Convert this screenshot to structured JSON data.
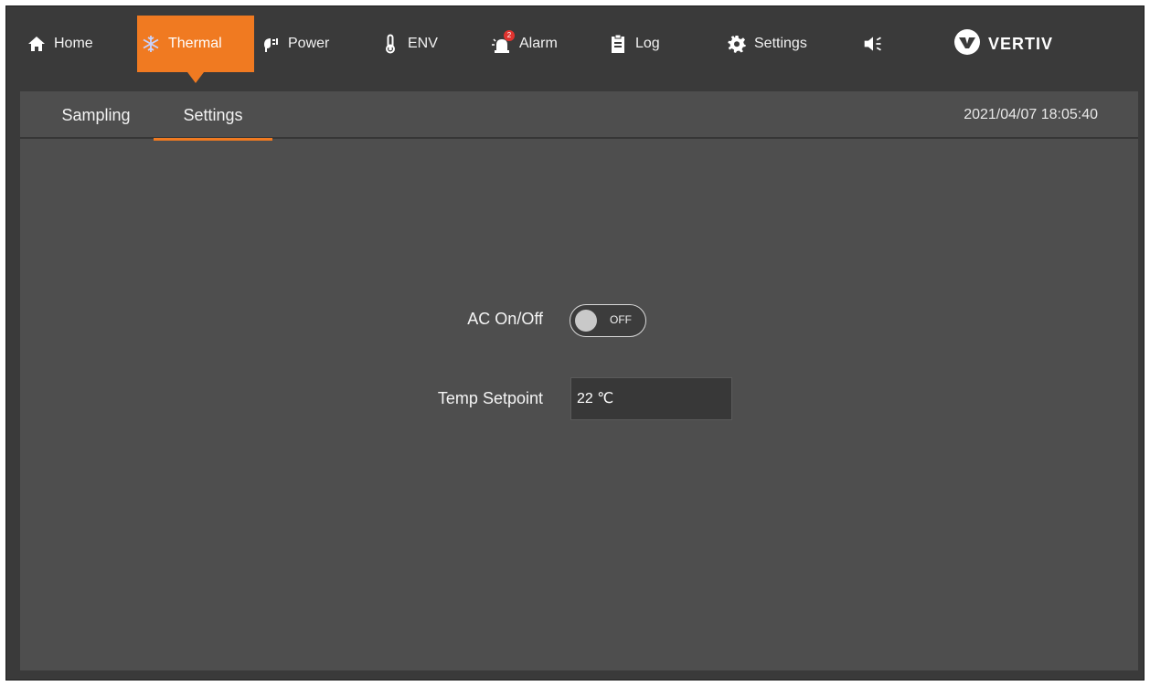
{
  "nav": {
    "items": [
      {
        "id": "home",
        "label": "Home",
        "icon": "home-icon"
      },
      {
        "id": "thermal",
        "label": "Thermal",
        "icon": "snowflake-icon",
        "active": true
      },
      {
        "id": "power",
        "label": "Power",
        "icon": "plug-icon"
      },
      {
        "id": "env",
        "label": "ENV",
        "icon": "thermometer-icon"
      },
      {
        "id": "alarm",
        "label": "Alarm",
        "icon": "alarm-light-icon",
        "badge": "2"
      },
      {
        "id": "log",
        "label": "Log",
        "icon": "clipboard-icon"
      },
      {
        "id": "settings",
        "label": "Settings",
        "icon": "gear-icon"
      }
    ],
    "sound_icon": "speaker-icon",
    "brand": {
      "name": "VERTIV",
      "icon": "vertiv-logo-icon"
    }
  },
  "subnav": {
    "tabs": [
      {
        "label": "Sampling",
        "active": false
      },
      {
        "label": "Settings",
        "active": true
      }
    ],
    "datetime": "2021/04/07 18:05:40"
  },
  "form": {
    "ac_label": "AC On/Off",
    "ac_state": "OFF",
    "setpoint_label": "Temp Setpoint",
    "setpoint_value": "22 ℃"
  },
  "colors": {
    "accent": "#f07a21",
    "header_bg": "#3a3a3a",
    "panel_bg": "#4e4e4e",
    "badge": "#e0332f"
  }
}
